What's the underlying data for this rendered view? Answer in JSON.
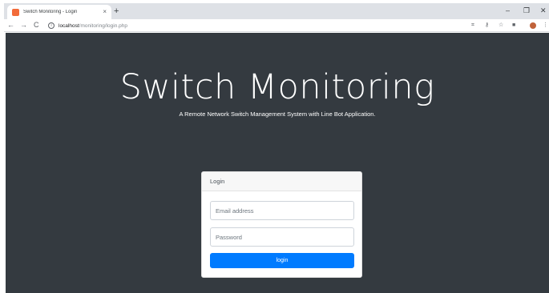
{
  "browser": {
    "tab_title": "Switch Monitoring - Login",
    "tab_close": "×",
    "new_tab": "+",
    "window_controls": {
      "minimize": "–",
      "restore": "❐",
      "close": "✕"
    },
    "nav": {
      "back": "←",
      "forward": "→",
      "reload": "C"
    },
    "url_host": "localhost",
    "url_path": "/monitoring/login.php",
    "toolbar_icons": [
      "translate-icon",
      "key-icon",
      "star-icon",
      "extension-icon",
      "profile-icon",
      "menu-icon"
    ]
  },
  "hero": {
    "title": "Switch Monitoring",
    "subtitle": "A Remote Network Switch Management System with Line Bot Application."
  },
  "login_card": {
    "header": "Login",
    "email_placeholder": "Email address",
    "email_value": "",
    "password_placeholder": "Password",
    "password_value": "",
    "submit_label": "login"
  },
  "colors": {
    "page_background": "#343a40",
    "primary_button": "#007bff",
    "favicon": "#f26b3a"
  }
}
